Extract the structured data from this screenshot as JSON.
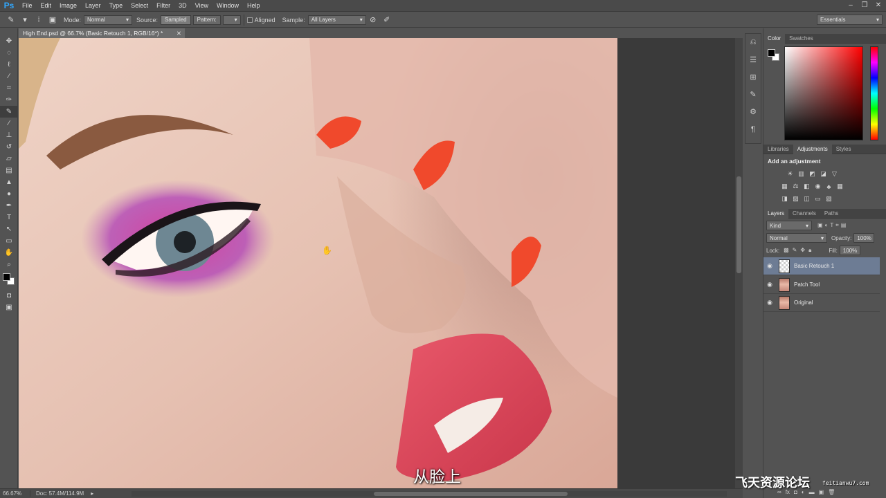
{
  "app": {
    "logo": "Ps"
  },
  "menu": [
    "File",
    "Edit",
    "Image",
    "Layer",
    "Type",
    "Select",
    "Filter",
    "3D",
    "View",
    "Window",
    "Help"
  ],
  "options": {
    "mode_label": "Mode:",
    "mode_value": "Normal",
    "source_label": "Source:",
    "source_sampled": "Sampled",
    "source_pattern": "Pattern:",
    "aligned_label": "Aligned",
    "sample_label": "Sample:",
    "sample_value": "All Layers",
    "workspace": "Essentials"
  },
  "document": {
    "tab_title": "High End.psd @ 66.7% (Basic Retouch 1, RGB/16*) *",
    "zoom": "66.67%",
    "doc_info": "Doc: 57.4M/114.9M"
  },
  "subtitle": "从脸上",
  "panels": {
    "color_tabs": [
      "Color",
      "Swatches"
    ],
    "adjust_tabs": [
      "Libraries",
      "Adjustments",
      "Styles"
    ],
    "adjust_title": "Add an adjustment",
    "layers_tabs": [
      "Layers",
      "Channels",
      "Paths"
    ],
    "kind_label": "Kind",
    "blend_mode": "Normal",
    "opacity_label": "Opacity:",
    "opacity_value": "100%",
    "lock_label": "Lock:",
    "fill_label": "Fill:",
    "fill_value": "100%",
    "layers": [
      {
        "name": "Basic Retouch 1"
      },
      {
        "name": "Patch Tool"
      },
      {
        "name": "Original"
      }
    ]
  },
  "watermark": {
    "text": "飞天资源论坛",
    "url": "feitianwu7.com"
  },
  "colors": {
    "foreground": "#000000",
    "background": "#ffffff",
    "selected_layer": "#6d7c94",
    "nail": "#f0492c",
    "lip": "#e0475a"
  }
}
